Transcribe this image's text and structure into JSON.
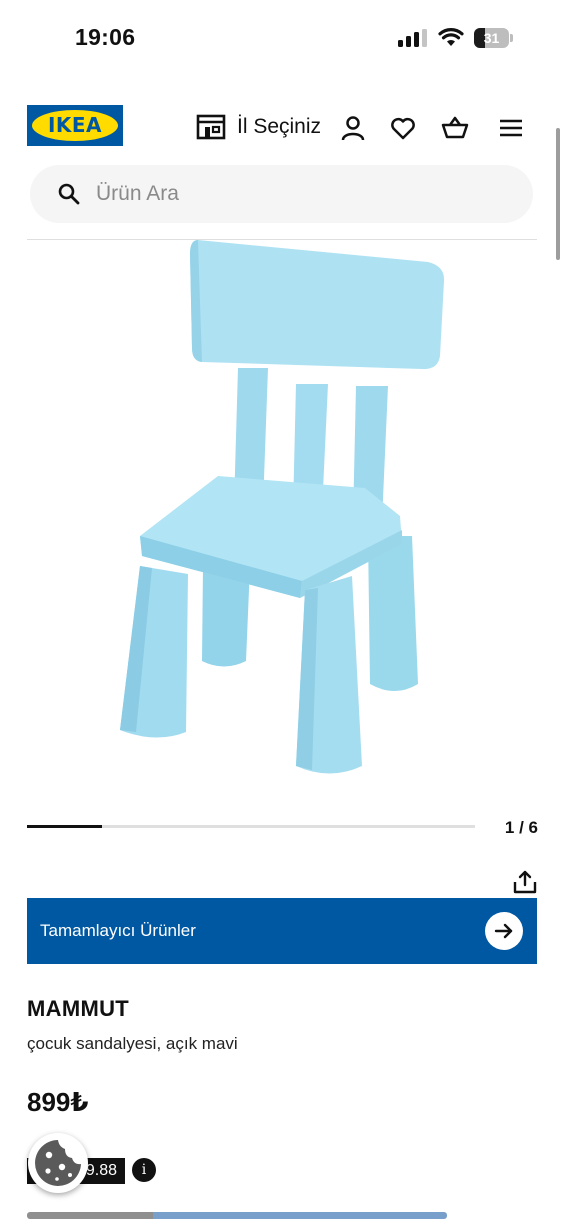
{
  "status_bar": {
    "time": "19:06",
    "battery_percent": 31,
    "battery_label": "31"
  },
  "header": {
    "logo_text": "IKEA",
    "store_selector_label": "İl Seçiniz",
    "icons": [
      "store-icon",
      "user-icon",
      "heart-icon",
      "basket-icon",
      "menu-icon"
    ]
  },
  "search": {
    "placeholder": "Ürün Ara",
    "value": ""
  },
  "gallery": {
    "current": 1,
    "total": 6,
    "counter_text": "1 / 6",
    "progress_fraction": 0.1667
  },
  "complementary": {
    "label": "Tamamlayıcı Ürünler"
  },
  "product": {
    "name": "MAMMUT",
    "description": "çocuk sandalyesi, açık mavi",
    "price": "899₺",
    "tag_text": "9.88",
    "color": "#a8e0f2"
  },
  "colors": {
    "brand_blue": "#0058a3",
    "brand_yellow": "#ffdb00"
  }
}
